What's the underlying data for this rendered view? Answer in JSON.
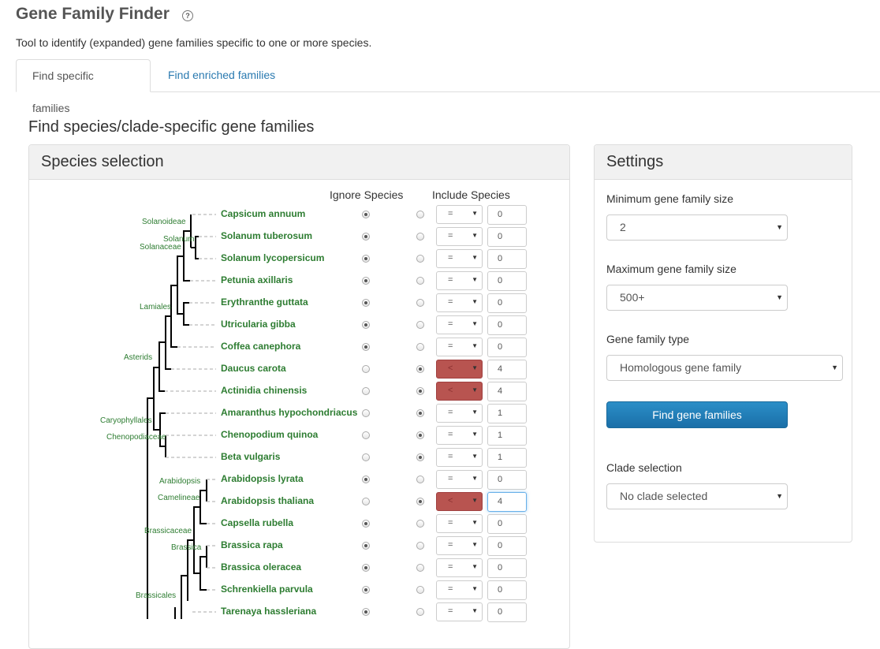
{
  "page": {
    "title": "Gene Family Finder",
    "help_icon": "?",
    "description": "Tool to identify (expanded) gene families specific to one or more species."
  },
  "tabs": [
    {
      "label": "Find specific families",
      "active": true
    },
    {
      "label": "Find enriched families",
      "active": false
    }
  ],
  "section_title": "Find species/clade-specific gene families",
  "species_panel": {
    "title": "Species selection",
    "col_ignore": "Ignore Species",
    "col_include": "Include Species",
    "rows": [
      {
        "name": "Capsicum annuum",
        "ignore": true,
        "op": "=",
        "count": "0",
        "highlight": false
      },
      {
        "name": "Solanum tuberosum",
        "ignore": true,
        "op": "=",
        "count": "0",
        "highlight": false
      },
      {
        "name": "Solanum lycopersicum",
        "ignore": true,
        "op": "=",
        "count": "0",
        "highlight": false
      },
      {
        "name": "Petunia axillaris",
        "ignore": true,
        "op": "=",
        "count": "0",
        "highlight": false
      },
      {
        "name": "Erythranthe guttata",
        "ignore": true,
        "op": "=",
        "count": "0",
        "highlight": false
      },
      {
        "name": "Utricularia gibba",
        "ignore": true,
        "op": "=",
        "count": "0",
        "highlight": false
      },
      {
        "name": "Coffea canephora",
        "ignore": true,
        "op": "=",
        "count": "0",
        "highlight": false
      },
      {
        "name": "Daucus carota",
        "ignore": false,
        "op": "<",
        "count": "4",
        "highlight": true
      },
      {
        "name": "Actinidia chinensis",
        "ignore": false,
        "op": "<",
        "count": "4",
        "highlight": true
      },
      {
        "name": "Amaranthus hypochondriacus",
        "ignore": false,
        "op": "=",
        "count": "1",
        "highlight": false
      },
      {
        "name": "Chenopodium quinoa",
        "ignore": false,
        "op": "=",
        "count": "1",
        "highlight": false
      },
      {
        "name": "Beta vulgaris",
        "ignore": false,
        "op": "=",
        "count": "1",
        "highlight": false
      },
      {
        "name": "Arabidopsis lyrata",
        "ignore": true,
        "op": "=",
        "count": "0",
        "highlight": false
      },
      {
        "name": "Arabidopsis thaliana",
        "ignore": false,
        "op": "<",
        "count": "4",
        "highlight": true,
        "focused": true
      },
      {
        "name": "Capsella rubella",
        "ignore": true,
        "op": "=",
        "count": "0",
        "highlight": false
      },
      {
        "name": "Brassica rapa",
        "ignore": true,
        "op": "=",
        "count": "0",
        "highlight": false
      },
      {
        "name": "Brassica oleracea",
        "ignore": true,
        "op": "=",
        "count": "0",
        "highlight": false
      },
      {
        "name": "Schrenkiella parvula",
        "ignore": true,
        "op": "=",
        "count": "0",
        "highlight": false
      },
      {
        "name": "Tarenaya hassleriana",
        "ignore": true,
        "op": "=",
        "count": "0",
        "highlight": false
      }
    ],
    "clades": [
      "Solanoideae",
      "Solanum",
      "Solanaceae",
      "Lamiales",
      "Asterids",
      "Caryophyllales",
      "Chenopodiaceae",
      "Arabidopsis",
      "Camelineae",
      "Brassicaceae",
      "Brassica",
      "Brassicales"
    ]
  },
  "settings": {
    "title": "Settings",
    "min_label": "Minimum gene family size",
    "min_value": "2",
    "max_label": "Maximum gene family size",
    "max_value": "500+",
    "type_label": "Gene family type",
    "type_value": "Homologous gene family",
    "button": "Find gene families",
    "clade_label": "Clade selection",
    "clade_value": "No clade selected"
  },
  "colors": {
    "species_green": "#2e7d32",
    "highlight_red": "#b85450",
    "button_blue": "#1f7fb8",
    "link_blue": "#2a7ab0"
  }
}
